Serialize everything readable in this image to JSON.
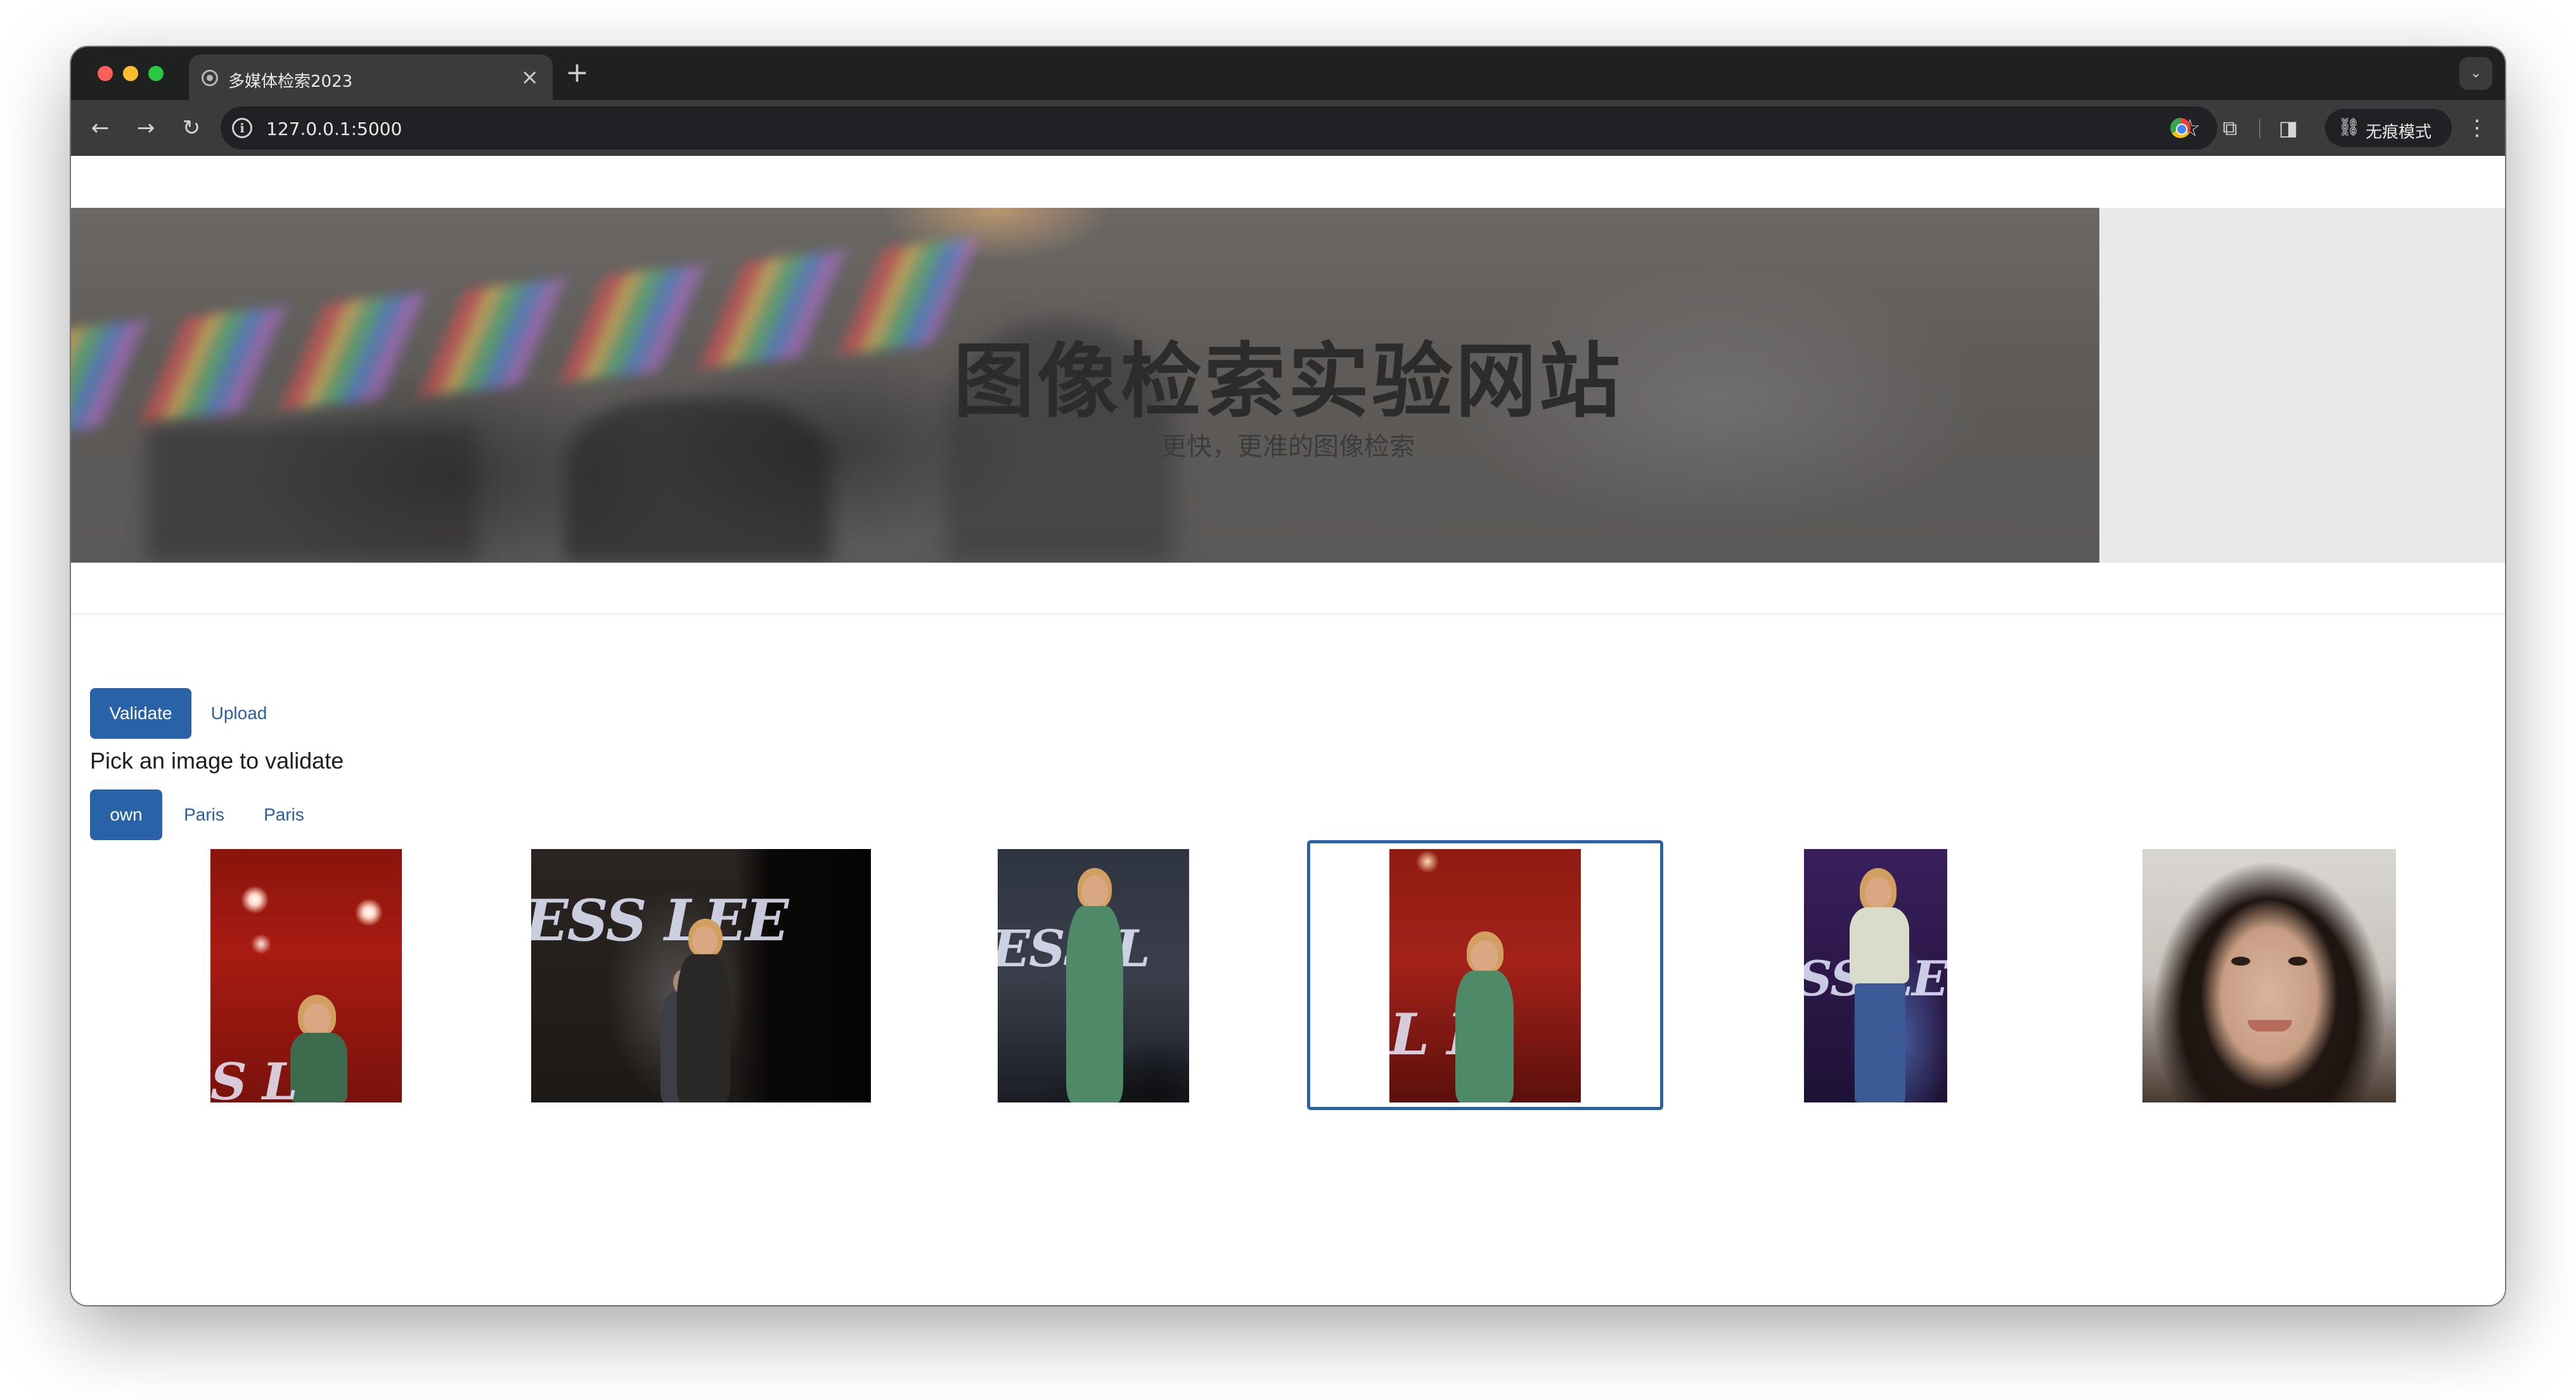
{
  "browser": {
    "tab_title": "多媒体检索2023",
    "tab_close": "×",
    "new_tab": "+",
    "tab_menu": "⌄",
    "url": "127.0.0.1:5000",
    "incognito_label": "无痕模式",
    "icons": {
      "back": "back-arrow-icon",
      "forward": "forward-arrow-icon",
      "reload": "reload-icon",
      "info": "site-info-icon",
      "star": "bookmark-star-icon",
      "extensions": "puzzle-icon",
      "sidepanel": "side-panel-icon",
      "incognito": "incognito-icon",
      "menu": "kebab-menu-icon"
    }
  },
  "hero": {
    "title": "图像检索实验网站",
    "subtitle": "更快，更准的图像检索"
  },
  "tabs": [
    {
      "label": "Validate",
      "active": true
    },
    {
      "label": "Upload",
      "active": false
    }
  ],
  "section_title": "Pick an image to validate",
  "filters": [
    {
      "label": "own",
      "active": true
    },
    {
      "label": "Paris",
      "active": false
    },
    {
      "label": "Paris",
      "active": false
    }
  ],
  "images": [
    {
      "alt": "singer on red stage",
      "selected": false
    },
    {
      "alt": "singer on stage with band",
      "selected": false
    },
    {
      "alt": "singer in green dress",
      "selected": false
    },
    {
      "alt": "singer in green dress on red stage",
      "selected": true
    },
    {
      "alt": "singer in white top and jeans",
      "selected": false
    },
    {
      "alt": "selfie portrait",
      "selected": false
    }
  ],
  "colors": {
    "accent": "#2a62a8",
    "link": "#2a5fa0",
    "browser_dark": "#1f2020",
    "toolbar": "#3a3b3c"
  }
}
